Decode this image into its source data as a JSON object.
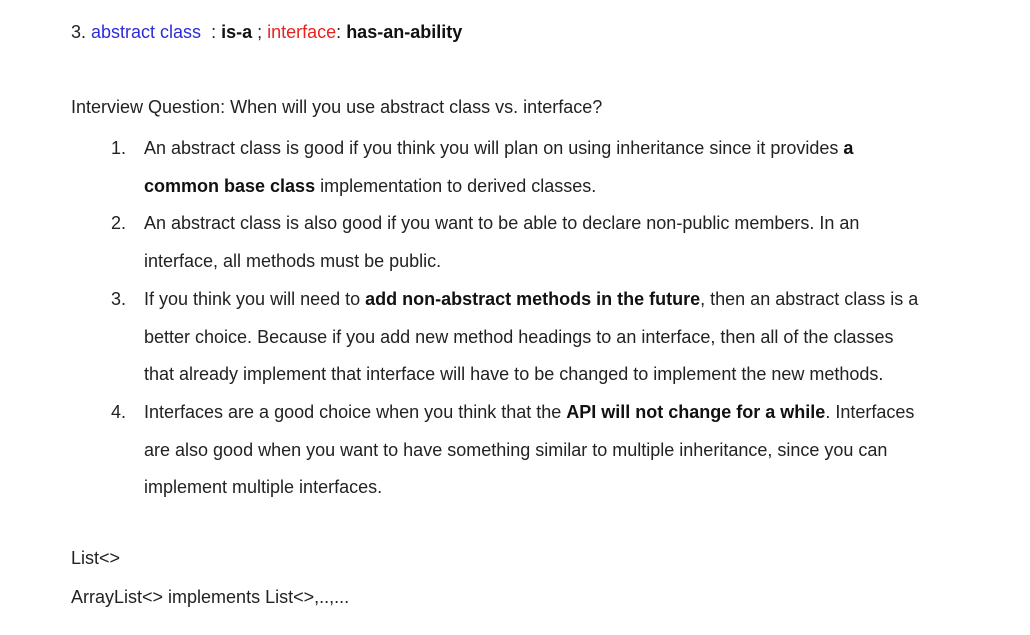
{
  "heading": {
    "prefix": "3. ",
    "abstract_label": "abstract class",
    "sep1": "  : ",
    "is_a": "is-a",
    "sep2": " ; ",
    "interface_label": "interface",
    "sep3": ": ",
    "has_ability": "has-an-ability"
  },
  "question": "Interview Question: When will you use abstract class vs. interface?",
  "items": [
    {
      "num": "1.",
      "before": " An abstract class is good if you think you will plan on using inheritance since it provides ",
      "bold": "a common base class",
      "after": " implementation to derived classes."
    },
    {
      "num": "2.",
      "before": "An abstract class is also good if you want to be able to declare non-public members. In an interface, all methods must be public.",
      "bold": "",
      "after": ""
    },
    {
      "num": "3.",
      "before": "If you think you will need to ",
      "bold": "add non-abstract methods in the future",
      "after": ", then an abstract class is a better choice. Because if you add new method headings to an interface, then all of the classes that already implement that interface will have to be changed to implement the new methods."
    },
    {
      "num": "4.",
      "before": "Interfaces are a good choice when you think that the ",
      "bold": "API will not change for a while",
      "after": ". Interfaces are also good when you want to have something similar to multiple inheritance, since you can implement multiple interfaces."
    }
  ],
  "footer": {
    "line1": "List<>",
    "line2": "ArrayList<> implements List<>,..,..."
  },
  "colors": {
    "abstract_label": "#2c2cd8",
    "interface_label": "#e8231f",
    "text": "#222222"
  }
}
